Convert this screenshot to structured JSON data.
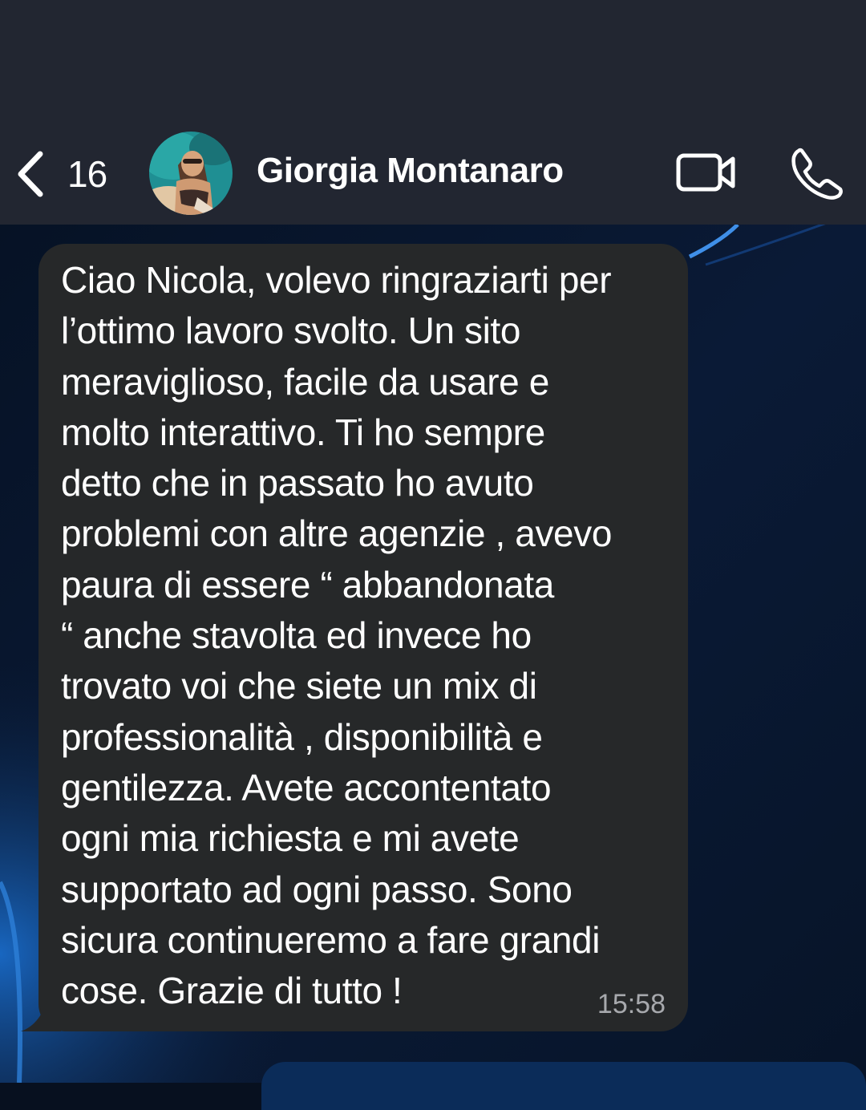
{
  "header": {
    "back_count": "16",
    "contact_name": "Giorgia Montanaro"
  },
  "message": {
    "text": "Ciao Nicola, volevo ringraziarti per\nl’ottimo lavoro svolto. Un sito\nmeraviglioso, facile da usare e\nmolto interattivo. Ti ho sempre\ndetto che in passato ho avuto\nproblemi con altre agenzie , avevo\npaura di essere “ abbandonata\n“ anche stavolta ed invece ho\ntrovato voi che siete un mix di\nprofessionalità , disponibilità e\ngentilezza. Avete accontentato\nogni mia richiesta e mi avete\nsupportato ad ogni passo. Sono\nsicura continueremo a fare grandi\ncose. Grazie di tutto !",
    "time": "15:58"
  },
  "icons": {
    "back": "chevron-left-icon",
    "video": "video-camera-icon",
    "call": "phone-icon"
  },
  "colors": {
    "header_background": "#222631",
    "incoming_bubble": "#262829",
    "outgoing_bubble": "#0b2c59",
    "chat_background": "#07101f",
    "time_text": "#a7a9ad"
  }
}
